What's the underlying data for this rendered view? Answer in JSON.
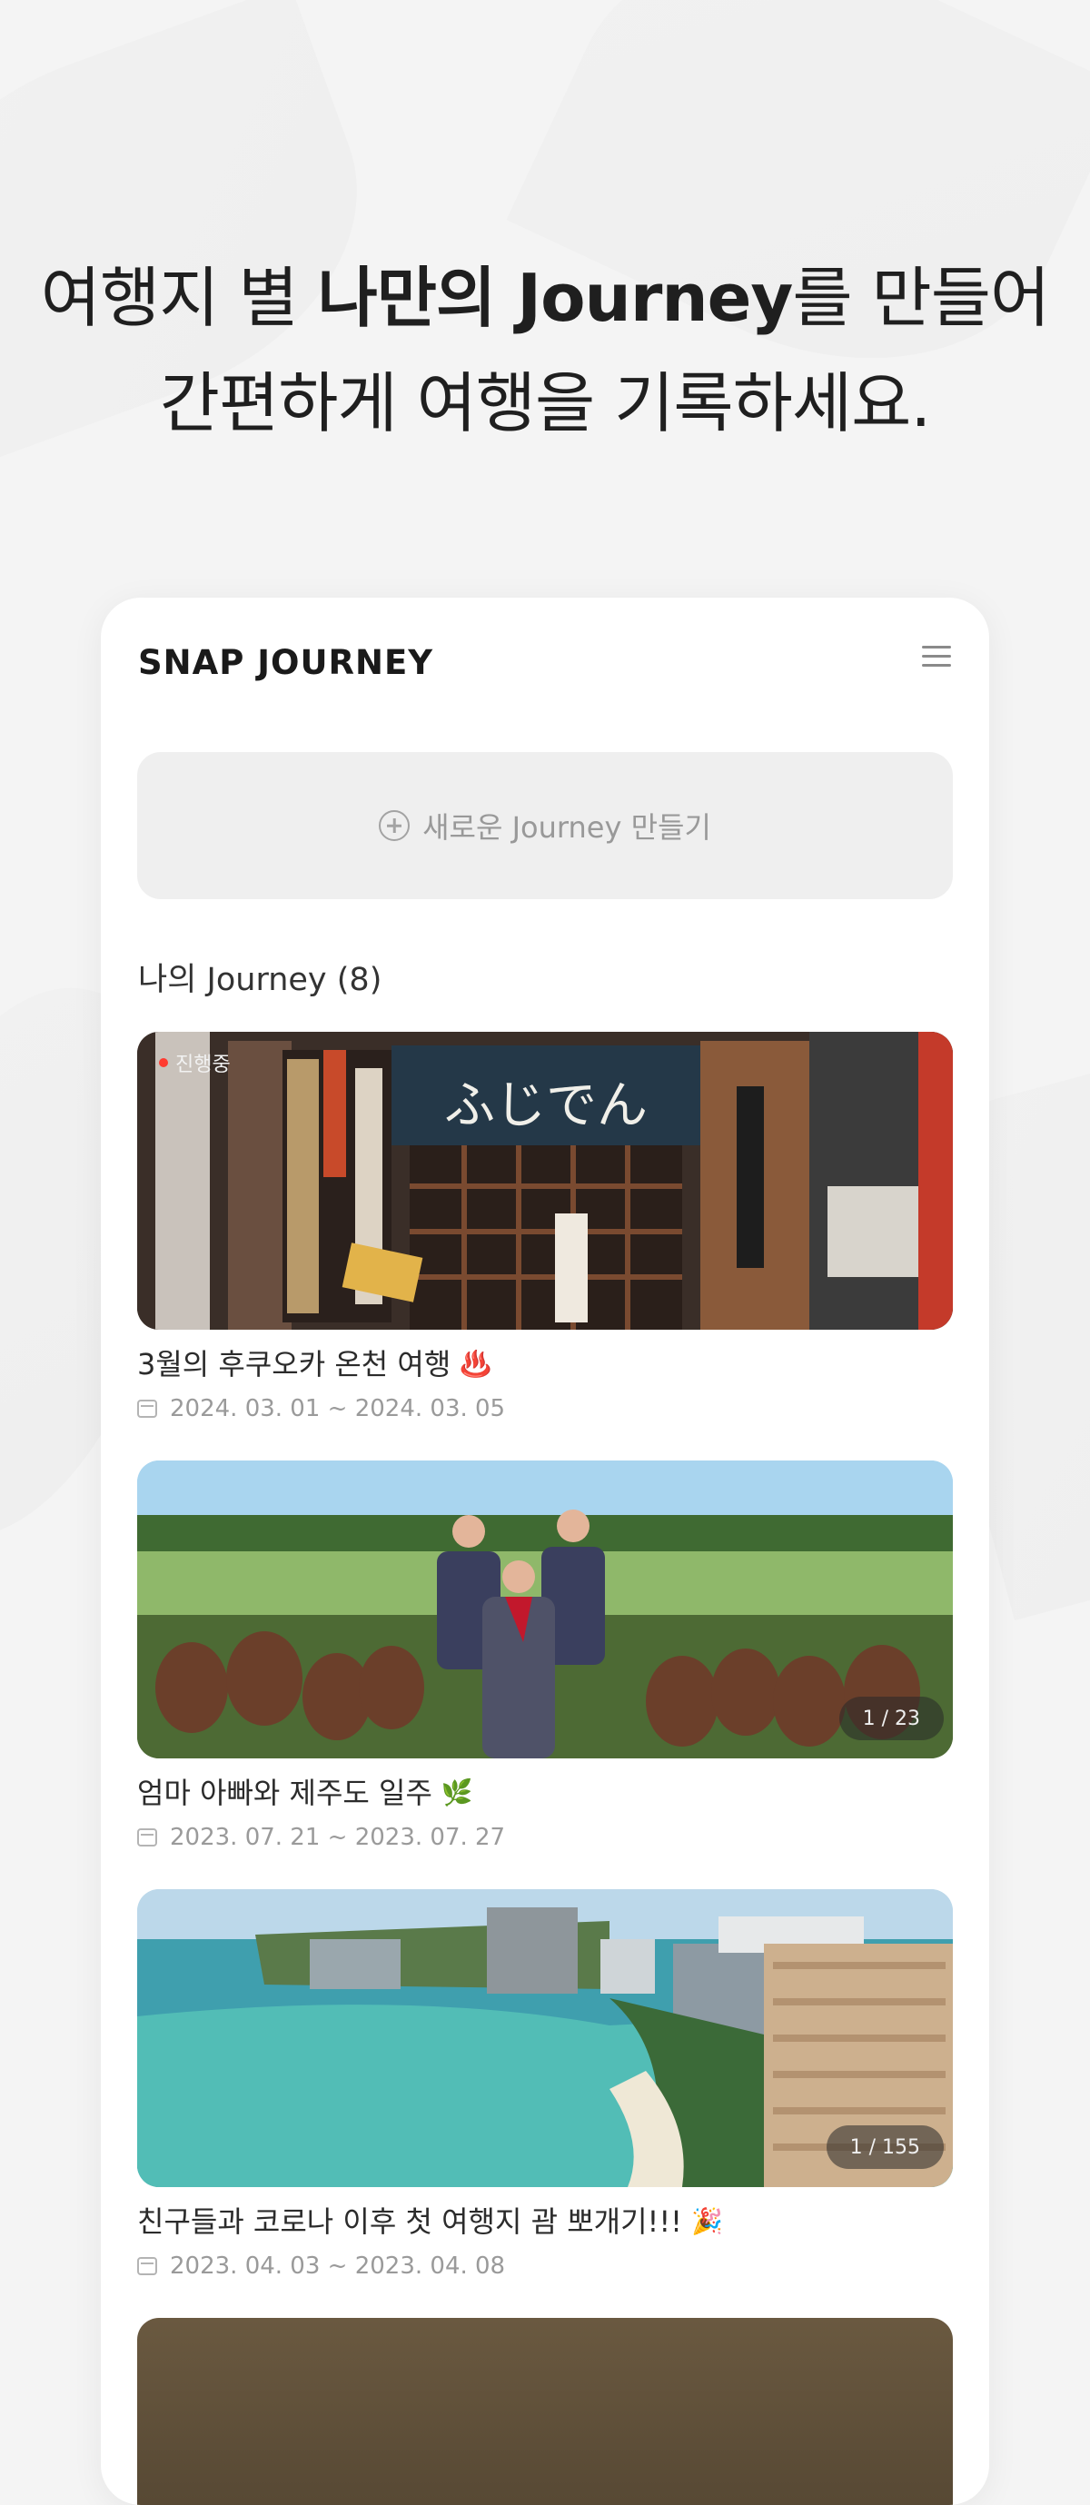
{
  "headline": {
    "line1_part1": "여행지 별 ",
    "line1_bold": "나만의 Journey",
    "line1_part2": "를 만들어",
    "line2": "간편하게 여행을 기록하세요."
  },
  "app": {
    "title": "SNAP JOURNEY",
    "menu_icon": "hamburger-menu-icon"
  },
  "new_journey": {
    "label": "새로운 Journey 만들기",
    "icon": "plus-circle-icon"
  },
  "journeys": {
    "heading": "나의 Journey (8)",
    "items": [
      {
        "title": "3월의 후쿠오카 온천 여행",
        "emoji": "♨️",
        "dates": "2024. 03. 01 ~ 2024. 03. 05",
        "badge": "진행중",
        "counter": ""
      },
      {
        "title": "엄마 아빠와 제주도 일주",
        "emoji": "🌿",
        "dates": "2023. 07. 21 ~ 2023. 07. 27",
        "badge": "",
        "counter": "1 / 23"
      },
      {
        "title": "친구들과 코로나 이후 첫 여행지 괌 뽀개기!!!",
        "emoji": "🎉",
        "dates": "2023. 04. 03 ~ 2023. 04. 08",
        "badge": "",
        "counter": "1 / 155"
      }
    ]
  },
  "colors": {
    "background": "#f4f4f4",
    "card": "#ffffff",
    "live_dot": "#ff3b30",
    "button_bg": "#efefef"
  }
}
